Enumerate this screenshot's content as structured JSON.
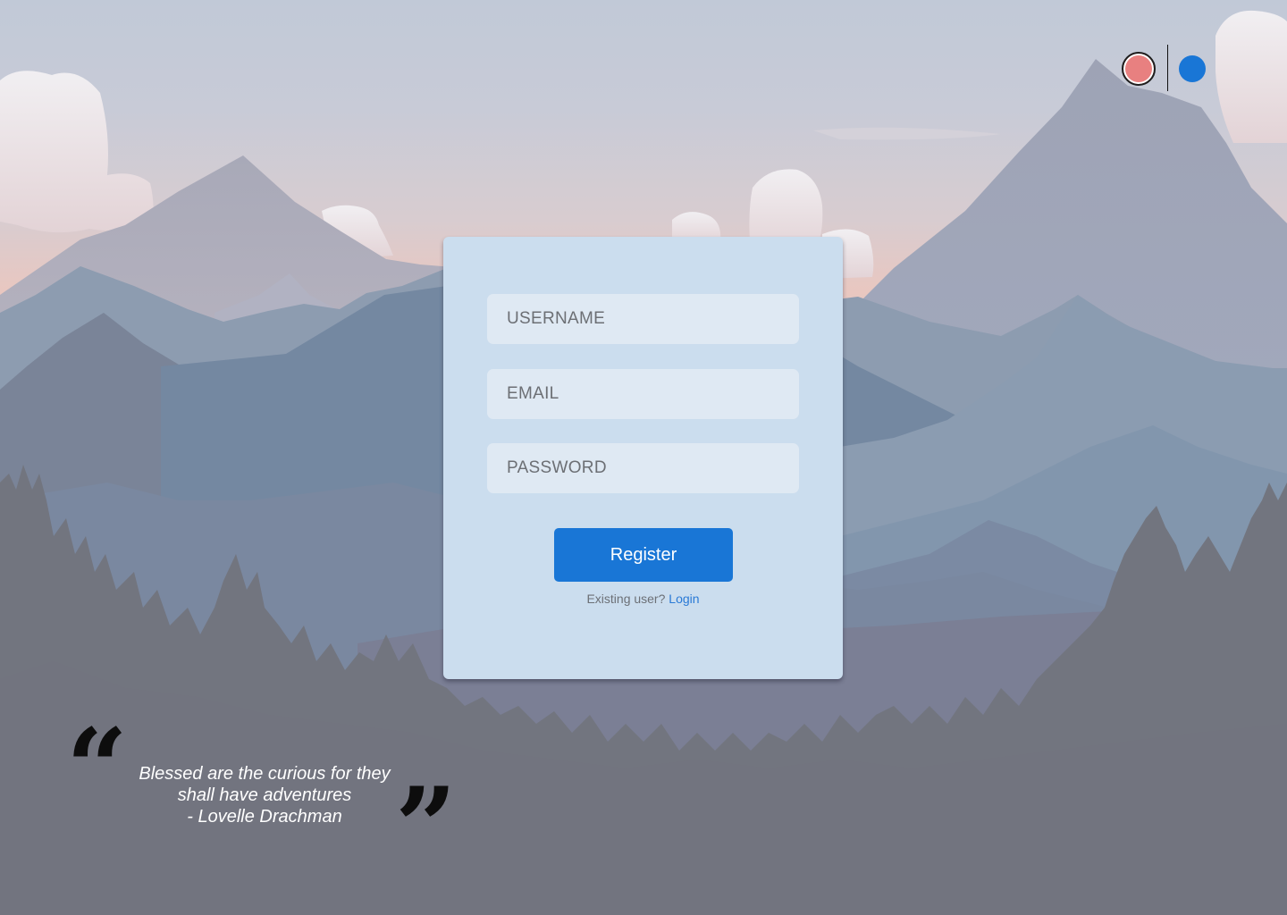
{
  "theme": {
    "swatches": [
      {
        "name": "coral",
        "color": "#e88080",
        "selected": true
      },
      {
        "name": "blue",
        "color": "#1976d6",
        "selected": false
      }
    ]
  },
  "form": {
    "username_placeholder": "USERNAME",
    "email_placeholder": "EMAIL",
    "password_placeholder": "PASSWORD",
    "register_label": "Register",
    "existing_user_text": "Existing user?",
    "login_label": "Login"
  },
  "quote": {
    "lines": [
      "Blessed are the curious for they",
      "shall have adventures",
      "- Lovelle Drachman"
    ]
  },
  "colors": {
    "accent": "#1976d6",
    "card": "#cbddee",
    "field": "#dfe9f3"
  }
}
